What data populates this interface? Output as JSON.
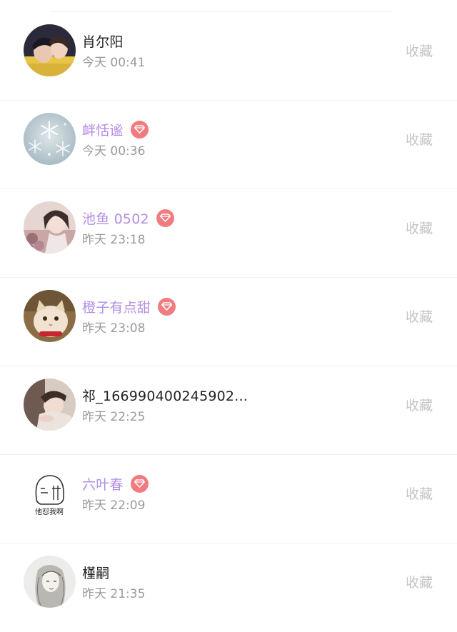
{
  "colors": {
    "vip_name": "#b38ee6",
    "normal_name": "#222222",
    "time": "#9a9a9a",
    "favorite_action": "#c4c4c4",
    "vip_badge": "#f27b7f"
  },
  "visitors": [
    {
      "name": "肖尔阳",
      "time": "今天 00:41",
      "vip": false,
      "action": "收藏",
      "avatar": "couple-photo-avatar"
    },
    {
      "name": "衅恬谧",
      "time": "今天 00:36",
      "vip": true,
      "action": "收藏",
      "avatar": "snowflake-avatar"
    },
    {
      "name": "池鱼 0502",
      "time": "昨天 23:18",
      "vip": true,
      "action": "收藏",
      "avatar": "girl-flowers-avatar"
    },
    {
      "name": "橙子有点甜",
      "time": "昨天 23:08",
      "vip": true,
      "action": "收藏",
      "avatar": "cat-avatar"
    },
    {
      "name": "祁_166990400245902...",
      "time": "昨天 22:25",
      "vip": false,
      "action": "收藏",
      "avatar": "sleeping-girl-avatar"
    },
    {
      "name": "六叶春",
      "time": "昨天 22:09",
      "vip": true,
      "action": "收藏",
      "avatar": "cartoon-sticker-avatar",
      "avatar_caption": "他怼我啊"
    },
    {
      "name": "槿嗣",
      "time": "昨天 21:35",
      "vip": false,
      "action": "收藏",
      "avatar": "sketch-girl-avatar"
    }
  ]
}
